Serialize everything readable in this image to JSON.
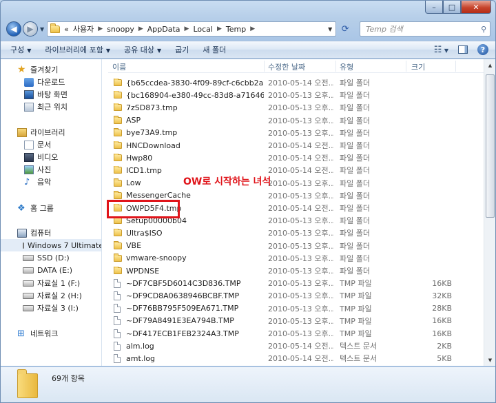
{
  "window": {
    "caption": {
      "minimize": "–",
      "maximize": "□",
      "close": "✕"
    }
  },
  "address": {
    "prefix": "«",
    "crumbs": [
      "사용자",
      "snoopy",
      "AppData",
      "Local",
      "Temp"
    ],
    "search_placeholder": "Temp 검색"
  },
  "toolbar": {
    "organize": "구성",
    "include_library": "라이브러리에 포함",
    "share": "공유 대상",
    "burn": "굽기",
    "new_folder": "새 폴더"
  },
  "sidebar": {
    "items": [
      {
        "label": "즐겨찾기",
        "icon": "star-icon"
      },
      {
        "label": "다운로드",
        "icon": "download-icon"
      },
      {
        "label": "바탕 화면",
        "icon": "desktop-icon"
      },
      {
        "label": "최근 위치",
        "icon": "recent-places-icon"
      },
      {
        "label": "라이브러리",
        "icon": "library-icon"
      },
      {
        "label": "문서",
        "icon": "documents-icon"
      },
      {
        "label": "비디오",
        "icon": "videos-icon"
      },
      {
        "label": "사진",
        "icon": "pictures-icon"
      },
      {
        "label": "음악",
        "icon": "music-icon"
      },
      {
        "label": "홈 그룹",
        "icon": "homegroup-icon"
      },
      {
        "label": "컴퓨터",
        "icon": "computer-icon"
      },
      {
        "label": "Windows 7 Ultimate",
        "icon": "drive-icon"
      },
      {
        "label": "SSD (D:)",
        "icon": "drive-icon"
      },
      {
        "label": "DATA (E:)",
        "icon": "drive-icon"
      },
      {
        "label": "자료실 1 (F:)",
        "icon": "drive-icon"
      },
      {
        "label": "자료실 2 (H:)",
        "icon": "drive-icon"
      },
      {
        "label": "자료실 3 (I:)",
        "icon": "drive-icon"
      },
      {
        "label": "네트워크",
        "icon": "network-icon"
      }
    ]
  },
  "columns": {
    "name": "이름",
    "modified": "수정한 날짜",
    "type": "유형",
    "size": "크기"
  },
  "files": [
    {
      "name": "{b65ccdea-3830-4f09-89cf-c6cbb2a63...",
      "date": "2010-05-14 오전...",
      "type": "파일 폴더",
      "size": "",
      "kind": "folder"
    },
    {
      "name": "{bc168904-e380-49cc-83d8-a7164678...",
      "date": "2010-05-13 오후...",
      "type": "파일 폴더",
      "size": "",
      "kind": "folder"
    },
    {
      "name": "7zSD873.tmp",
      "date": "2010-05-13 오후...",
      "type": "파일 폴더",
      "size": "",
      "kind": "folder"
    },
    {
      "name": "ASP",
      "date": "2010-05-13 오후...",
      "type": "파일 폴더",
      "size": "",
      "kind": "folder"
    },
    {
      "name": "bye73A9.tmp",
      "date": "2010-05-13 오후...",
      "type": "파일 폴더",
      "size": "",
      "kind": "folder"
    },
    {
      "name": "HNCDownload",
      "date": "2010-05-14 오전...",
      "type": "파일 폴더",
      "size": "",
      "kind": "folder"
    },
    {
      "name": "Hwp80",
      "date": "2010-05-14 오전...",
      "type": "파일 폴더",
      "size": "",
      "kind": "folder"
    },
    {
      "name": "ICD1.tmp",
      "date": "2010-05-14 오전...",
      "type": "파일 폴더",
      "size": "",
      "kind": "folder"
    },
    {
      "name": "Low",
      "date": "2010-05-13 오후...",
      "type": "파일 폴더",
      "size": "",
      "kind": "folder"
    },
    {
      "name": "MessengerCache",
      "date": "2010-05-13 오후...",
      "type": "파일 폴더",
      "size": "",
      "kind": "folder"
    },
    {
      "name": "OWPD5F4.tmp",
      "date": "2010-05-14 오전...",
      "type": "파일 폴더",
      "size": "",
      "kind": "folder"
    },
    {
      "name": "Setup00000b04",
      "date": "2010-05-13 오후...",
      "type": "파일 폴더",
      "size": "",
      "kind": "folder"
    },
    {
      "name": "Ultra$ISO",
      "date": "2010-05-13 오후...",
      "type": "파일 폴더",
      "size": "",
      "kind": "folder"
    },
    {
      "name": "VBE",
      "date": "2010-05-13 오후...",
      "type": "파일 폴더",
      "size": "",
      "kind": "folder"
    },
    {
      "name": "vmware-snoopy",
      "date": "2010-05-13 오후...",
      "type": "파일 폴더",
      "size": "",
      "kind": "folder"
    },
    {
      "name": "WPDNSE",
      "date": "2010-05-13 오후...",
      "type": "파일 폴더",
      "size": "",
      "kind": "folder"
    },
    {
      "name": "~DF7CBF5D6014C3D836.TMP",
      "date": "2010-05-13 오후...",
      "type": "TMP 파일",
      "size": "16KB",
      "kind": "file"
    },
    {
      "name": "~DF9CD8A0638946BCBF.TMP",
      "date": "2010-05-13 오후...",
      "type": "TMP 파일",
      "size": "32KB",
      "kind": "file"
    },
    {
      "name": "~DF76BB795F509EA671.TMP",
      "date": "2010-05-13 오후...",
      "type": "TMP 파일",
      "size": "28KB",
      "kind": "file"
    },
    {
      "name": "~DF79A8491E3EA794B.TMP",
      "date": "2010-05-13 오후...",
      "type": "TMP 파일",
      "size": "16KB",
      "kind": "file"
    },
    {
      "name": "~DF417ECB1FEB2324A3.TMP",
      "date": "2010-05-13 오후...",
      "type": "TMP 파일",
      "size": "16KB",
      "kind": "file"
    },
    {
      "name": "alm.log",
      "date": "2010-05-14 오전...",
      "type": "텍스트 문서",
      "size": "2KB",
      "kind": "file"
    },
    {
      "name": "amt.log",
      "date": "2010-05-14 오전...",
      "type": "텍스트 문서",
      "size": "5KB",
      "kind": "file"
    }
  ],
  "annotation": {
    "text": "OW로 시작하는 녀석"
  },
  "status": {
    "item_count": "69개 항목"
  }
}
